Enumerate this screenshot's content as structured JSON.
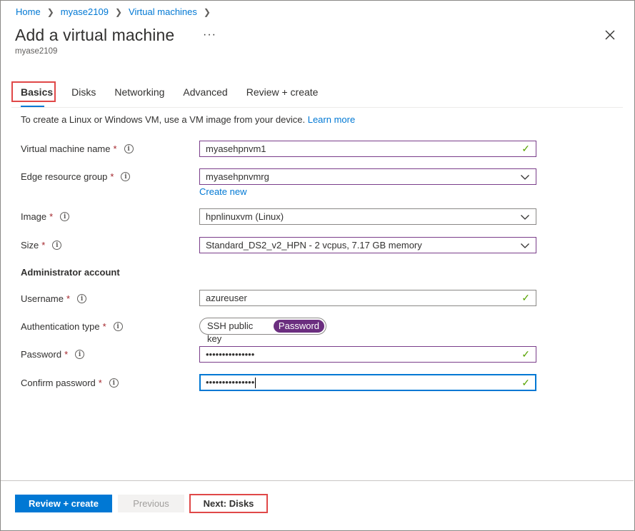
{
  "breadcrumb": {
    "items": [
      "Home",
      "myase2109",
      "Virtual machines"
    ]
  },
  "header": {
    "title": "Add a virtual machine",
    "more": "···",
    "subtitle": "myase2109"
  },
  "tabs": [
    {
      "label": "Basics",
      "active": true
    },
    {
      "label": "Disks"
    },
    {
      "label": "Networking"
    },
    {
      "label": "Advanced"
    },
    {
      "label": "Review + create"
    }
  ],
  "intro": {
    "text": "To create a Linux or Windows VM, use a VM image from your device. ",
    "link": "Learn more"
  },
  "fields": {
    "vm_name": {
      "label": "Virtual machine name",
      "value": "myasehpnvm1"
    },
    "edge_rg": {
      "label": "Edge resource group",
      "value": "myasehpnvmrg",
      "create_new": "Create new"
    },
    "image": {
      "label": "Image",
      "value": "hpnlinuxvm (Linux)"
    },
    "size": {
      "label": "Size",
      "value": "Standard_DS2_v2_HPN - 2 vcpus, 7.17 GB memory"
    },
    "section_admin": "Administrator account",
    "username": {
      "label": "Username",
      "value": "azureuser"
    },
    "auth_type": {
      "label": "Authentication type",
      "options": [
        "SSH public key",
        "Password"
      ],
      "selected": "Password"
    },
    "password": {
      "label": "Password",
      "value": "•••••••••••••••"
    },
    "confirm_password": {
      "label": "Confirm password",
      "value": "•••••••••••••••"
    }
  },
  "required_mark": "*",
  "info_glyph": "i",
  "check_glyph": "✓",
  "footer": {
    "review_create": "Review + create",
    "previous": "Previous",
    "next": "Next: Disks"
  },
  "colors": {
    "accent": "#0078d4",
    "highlight": "#e04848",
    "toggle_on": "#6b2e7f",
    "valid": "#57a300"
  }
}
